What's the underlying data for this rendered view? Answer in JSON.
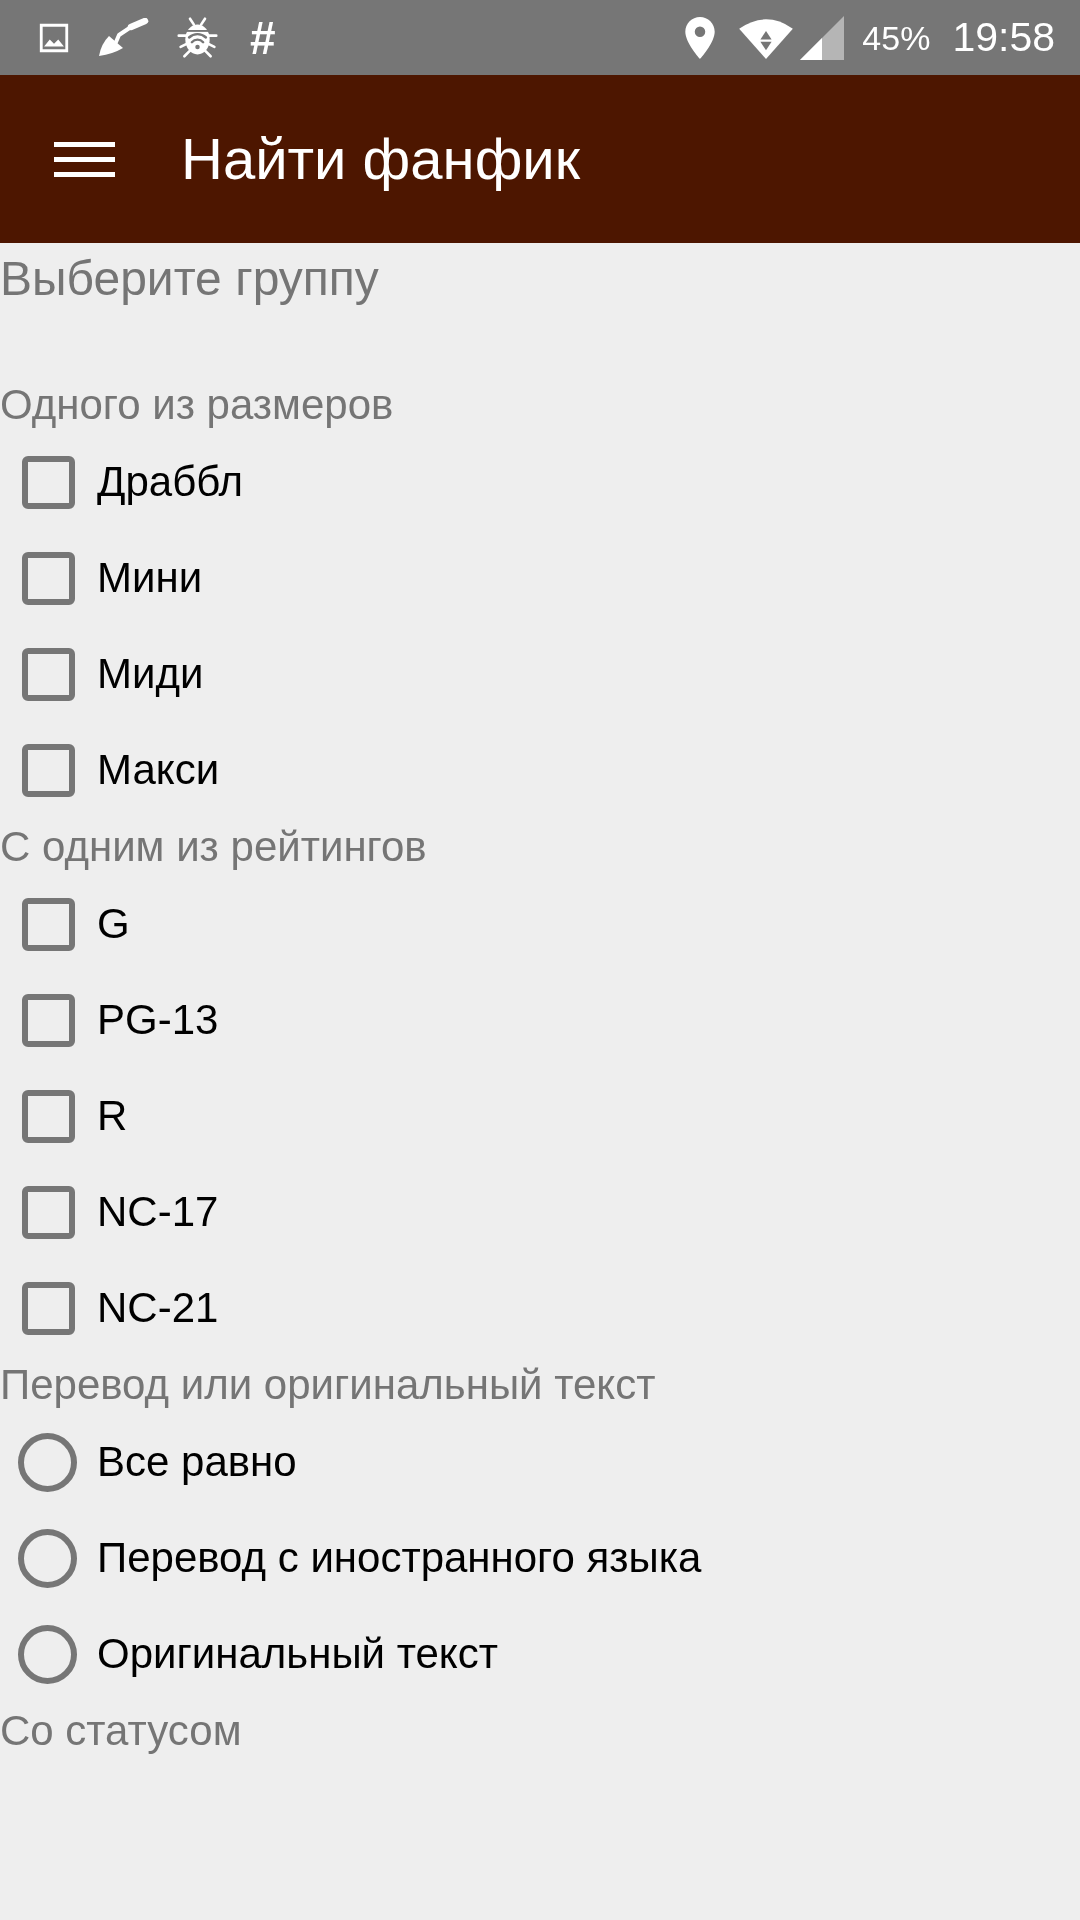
{
  "status_bar": {
    "notification_symbol": "#",
    "battery": "45%",
    "time": "19:58"
  },
  "app_bar": {
    "title": "Найти фанфик"
  },
  "form": {
    "group_label": "Выберите группу",
    "sections": [
      {
        "kind": "checkbox",
        "title": "Одного из размеров",
        "options": [
          {
            "label": "Драббл",
            "checked": false
          },
          {
            "label": "Мини",
            "checked": false
          },
          {
            "label": "Миди",
            "checked": false
          },
          {
            "label": "Макси",
            "checked": false
          }
        ]
      },
      {
        "kind": "checkbox",
        "title": "С одним из рейтингов",
        "options": [
          {
            "label": "G",
            "checked": false
          },
          {
            "label": "PG-13",
            "checked": false
          },
          {
            "label": "R",
            "checked": false
          },
          {
            "label": "NC-17",
            "checked": false
          },
          {
            "label": "NC-21",
            "checked": false
          }
        ]
      },
      {
        "kind": "radio",
        "title": "Перевод или оригинальный текст",
        "options": [
          {
            "label": "Все равно",
            "selected": false
          },
          {
            "label": "Перевод с иностранного языка",
            "selected": false
          },
          {
            "label": "Оригинальный текст",
            "selected": false
          }
        ]
      },
      {
        "title": "Со статусом"
      }
    ]
  }
}
